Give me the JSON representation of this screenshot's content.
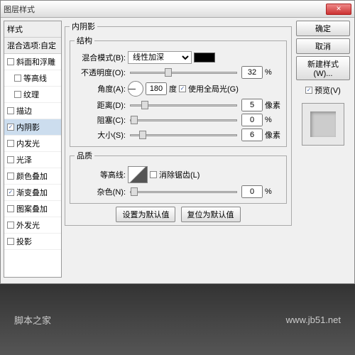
{
  "window": {
    "title": "图层样式"
  },
  "sidebar": {
    "header": "样式",
    "blend": "混合选项:自定",
    "items": [
      {
        "label": "斜面和浮雕",
        "checked": false,
        "indent": 0
      },
      {
        "label": "等高线",
        "checked": false,
        "indent": 1
      },
      {
        "label": "纹理",
        "checked": false,
        "indent": 1
      },
      {
        "label": "描边",
        "checked": false,
        "indent": 0
      },
      {
        "label": "内阴影",
        "checked": true,
        "indent": 0,
        "selected": true
      },
      {
        "label": "内发光",
        "checked": false,
        "indent": 0
      },
      {
        "label": "光泽",
        "checked": false,
        "indent": 0
      },
      {
        "label": "颜色叠加",
        "checked": false,
        "indent": 0
      },
      {
        "label": "渐变叠加",
        "checked": true,
        "indent": 0
      },
      {
        "label": "图案叠加",
        "checked": false,
        "indent": 0
      },
      {
        "label": "外发光",
        "checked": false,
        "indent": 0
      },
      {
        "label": "投影",
        "checked": false,
        "indent": 0
      }
    ]
  },
  "panel": {
    "title": "内阴影",
    "structure": {
      "legend": "结构",
      "blendmode": {
        "label": "混合模式(B):",
        "value": "线性加深"
      },
      "opacity": {
        "label": "不透明度(O):",
        "value": "32",
        "unit": "%",
        "pos": 32
      },
      "angle": {
        "label": "角度(A):",
        "value": "180",
        "unit": "度",
        "global": "使用全局光(G)",
        "globalChecked": true
      },
      "distance": {
        "label": "距离(D):",
        "value": "5",
        "unit": "像素",
        "pos": 10
      },
      "choke": {
        "label": "阻塞(C):",
        "value": "0",
        "unit": "%",
        "pos": 0
      },
      "size": {
        "label": "大小(S):",
        "value": "6",
        "unit": "像素",
        "pos": 8
      }
    },
    "quality": {
      "legend": "品质",
      "contour": {
        "label": "等高线:",
        "anti": "消除锯齿(L)",
        "antiChecked": false
      },
      "noise": {
        "label": "杂色(N):",
        "value": "0",
        "unit": "%",
        "pos": 0
      }
    },
    "buttons": {
      "default": "设置为默认值",
      "reset": "复位为默认值"
    }
  },
  "right": {
    "ok": "确定",
    "cancel": "取消",
    "newstyle": "新建样式(W)...",
    "preview": "预览(V)",
    "previewChecked": true
  },
  "footer": {
    "left": "脚本之家",
    "right": "www.jb51.net"
  }
}
